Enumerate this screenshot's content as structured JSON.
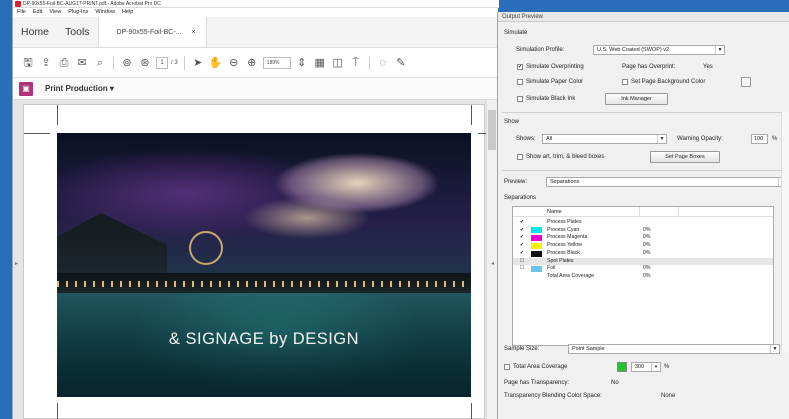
{
  "acrobat": {
    "title": "DP-90x55-Foil-BC-AUG17-PRINT.pdf - Adobe Acrobat Pro DC",
    "menu": [
      "File",
      "Edit",
      "View",
      "Plug-Ins",
      "Window",
      "Help"
    ],
    "tabs": {
      "home": "Home",
      "tools": "Tools",
      "doc": "DP-90x55-Foil-BC-...",
      "close": "×"
    },
    "page_current": "1",
    "page_total": "/ 3",
    "zoom": "189%",
    "tool_panel": "Print Production ▾",
    "artwork_text": "& SIGNAGE by DESIGN"
  },
  "output_preview": {
    "title": "Output Preview",
    "simulate_heading": "Simulate",
    "simulation_profile_label": "Simulation Profile:",
    "simulation_profile_value": "U.S. Web Coated (SWOP) v2",
    "simulate_overprinting": "Simulate Overprinting",
    "page_has_overprint_label": "Page has Overprint:",
    "page_has_overprint_value": "Yes",
    "simulate_paper_color": "Simulate Paper Color",
    "set_page_bg": "Set Page Background Color",
    "simulate_black_ink": "Simulate Black Ink",
    "ink_manager": "Ink Manager",
    "show_heading": "Show",
    "shows_label": "Shows:",
    "shows_value": "All",
    "warning_opacity_label": "Warning Opacity:",
    "warning_opacity_value": "100",
    "percent": "%",
    "show_art_trim": "Show art, trim, & bleed boxes",
    "set_page_boxes": "Set Page Boxes",
    "preview_label": "Preview:",
    "preview_value": "Separations",
    "separations_heading": "Separations",
    "table_header": "Name",
    "separations": [
      {
        "check": "✔",
        "color": "",
        "name": "Process Plates",
        "pct": ""
      },
      {
        "check": "✔",
        "color": "#00e5f0",
        "name": "Process Cyan",
        "pct": "0%"
      },
      {
        "check": "✔",
        "color": "#f000d0",
        "name": "Process Magenta",
        "pct": "0%"
      },
      {
        "check": "✔",
        "color": "#ffee00",
        "name": "Process Yellow",
        "pct": "0%"
      },
      {
        "check": "✔",
        "color": "#111111",
        "name": "Process Black",
        "pct": "0%"
      },
      {
        "check": "☐",
        "color": "",
        "name": "Spot Plates",
        "pct": ""
      },
      {
        "check": "☐",
        "color": "#6cc6e8",
        "name": "Foil",
        "pct": "0%"
      },
      {
        "check": "",
        "color": "",
        "name": "Total Area Coverage",
        "pct": "0%"
      }
    ],
    "sample_size_label": "Sample Size:",
    "sample_size_value": "Point Sample",
    "total_area_coverage": "Total Area Coverage",
    "tac_value": "300",
    "page_has_transparency_label": "Page has Transparency:",
    "page_has_transparency_value": "No",
    "blending_space_label": "Transparency Blending Color Space:",
    "blending_space_value": "None"
  }
}
